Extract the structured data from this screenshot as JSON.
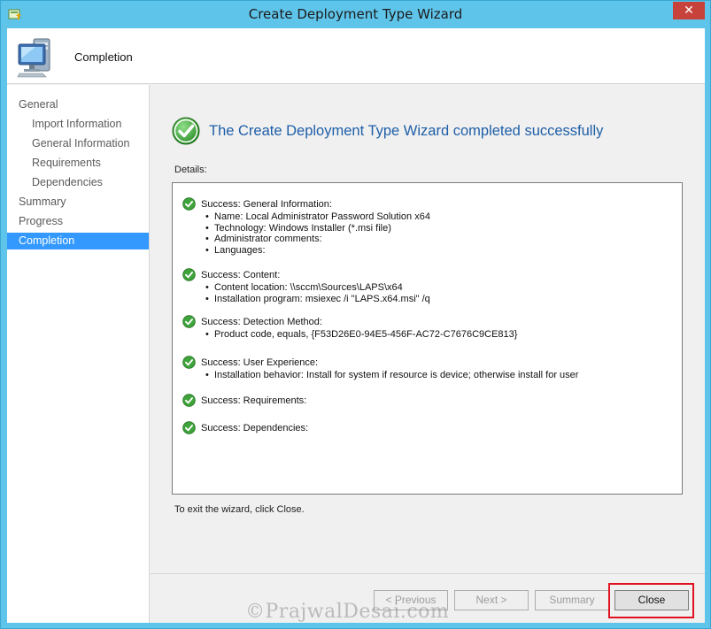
{
  "window": {
    "title": "Create Deployment Type Wizard",
    "close_symbol": "✕"
  },
  "header": {
    "title": "Completion",
    "icon": "computer-monitor-icon"
  },
  "nav": {
    "items": [
      {
        "label": "General",
        "level": 1,
        "selected": false
      },
      {
        "label": "Import Information",
        "level": 2,
        "selected": false
      },
      {
        "label": "General Information",
        "level": 2,
        "selected": false
      },
      {
        "label": "Requirements",
        "level": 2,
        "selected": false
      },
      {
        "label": "Dependencies",
        "level": 2,
        "selected": false
      },
      {
        "label": "Summary",
        "level": 1,
        "selected": false
      },
      {
        "label": "Progress",
        "level": 1,
        "selected": false
      },
      {
        "label": "Completion",
        "level": 1,
        "selected": true
      }
    ]
  },
  "main": {
    "headline": "The Create Deployment Type Wizard completed successfully",
    "details_label": "Details:",
    "exit_note": "To exit the wizard, click Close.",
    "groups": [
      {
        "heading": "Success: General Information:",
        "bullets": [
          "Name: Local Administrator Password Solution x64",
          "Technology: Windows Installer (*.msi file)",
          "Administrator comments:",
          "Languages:"
        ]
      },
      {
        "heading": "Success: Content:",
        "bullets": [
          "Content location: \\\\sccm\\Sources\\LAPS\\x64",
          "Installation program: msiexec /i \"LAPS.x64.msi\" /q"
        ]
      },
      {
        "heading": "Success: Detection Method:",
        "bullets": [
          "Product code, equals, {F53D26E0-94E5-456F-AC72-C7676C9CE813}"
        ]
      },
      {
        "heading": "Success: User Experience:",
        "bullets": [
          "Installation behavior: Install for system if resource is device; otherwise install for user"
        ]
      },
      {
        "heading": "Success: Requirements:",
        "bullets": []
      },
      {
        "heading": "Success: Dependencies:",
        "bullets": []
      }
    ]
  },
  "buttons": {
    "previous": "< Previous",
    "next": "Next >",
    "summary": "Summary",
    "close": "Close"
  },
  "watermark": "©PrajwalDesai.com",
  "colors": {
    "titlebar": "#5fc4ea",
    "nav_selected": "#3399ff",
    "headline": "#1e5fa8",
    "highlight": "#e0121f",
    "success_green": "#2e9a2e"
  }
}
